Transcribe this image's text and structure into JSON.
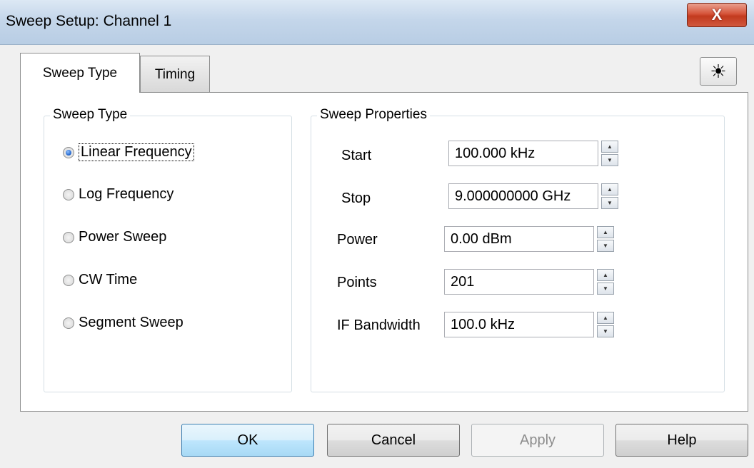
{
  "window": {
    "title": "Sweep Setup: Channel 1",
    "close_label": "X"
  },
  "tabs": [
    {
      "label": "Sweep Type",
      "active": true
    },
    {
      "label": "Timing",
      "active": false
    }
  ],
  "toolbar": {
    "sun_glyph": "☀"
  },
  "sweep_type": {
    "title": "Sweep Type",
    "options": [
      {
        "label": "Linear Frequency",
        "checked": true
      },
      {
        "label": "Log Frequency",
        "checked": false
      },
      {
        "label": "Power Sweep",
        "checked": false
      },
      {
        "label": "CW Time",
        "checked": false
      },
      {
        "label": "Segment Sweep",
        "checked": false
      }
    ]
  },
  "sweep_properties": {
    "title": "Sweep Properties",
    "fields": [
      {
        "label": "Start",
        "value": "100.000 kHz"
      },
      {
        "label": "Stop",
        "value": "9.000000000 GHz"
      },
      {
        "label": "Power",
        "value": "0.00 dBm"
      },
      {
        "label": "Points",
        "value": "201"
      },
      {
        "label": "IF Bandwidth",
        "value": "100.0 kHz"
      }
    ]
  },
  "buttons": {
    "ok": "OK",
    "cancel": "Cancel",
    "apply": "Apply",
    "help": "Help"
  },
  "colors": {
    "close_red": "#c23a1e",
    "focus_blue": "#3c7fb1",
    "radio_dot": "#1a5fc8"
  }
}
